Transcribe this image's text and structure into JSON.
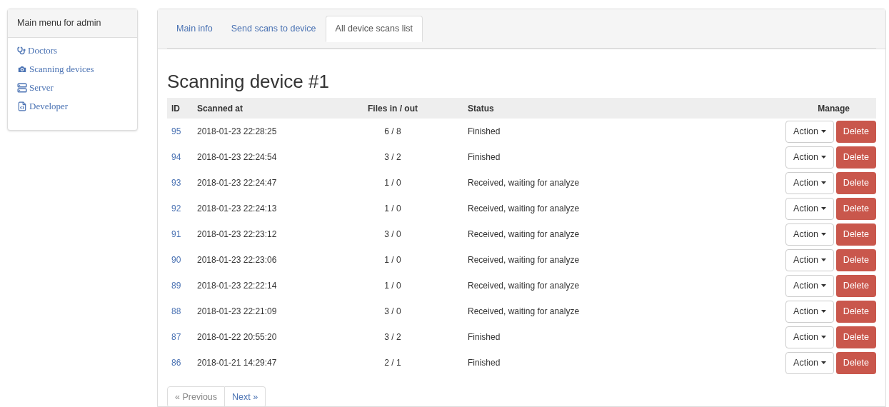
{
  "sidebar": {
    "title": "Main menu for admin",
    "items": [
      {
        "label": "Doctors"
      },
      {
        "label": "Scanning devices"
      },
      {
        "label": "Server"
      },
      {
        "label": "Developer"
      }
    ]
  },
  "tabs": [
    {
      "label": "Main info",
      "selected": false
    },
    {
      "label": "Send scans to device",
      "selected": false
    },
    {
      "label": "All device scans list",
      "selected": true
    }
  ],
  "heading": "Scanning device #1",
  "table": {
    "columns": [
      "ID",
      "Scanned at",
      "Files in / out",
      "Status",
      "Manage"
    ],
    "rows": [
      {
        "id": "95",
        "scanned_at": "2018-01-23 22:28:25",
        "files": "6 / 8",
        "status": "Finished",
        "action": "Action",
        "delete": "Delete"
      },
      {
        "id": "94",
        "scanned_at": "2018-01-23 22:24:54",
        "files": "3 / 2",
        "status": "Finished",
        "action": "Action",
        "delete": "Delete"
      },
      {
        "id": "93",
        "scanned_at": "2018-01-23 22:24:47",
        "files": "1 / 0",
        "status": "Received, waiting for analyze",
        "action": "Action",
        "delete": "Delete"
      },
      {
        "id": "92",
        "scanned_at": "2018-01-23 22:24:13",
        "files": "1 / 0",
        "status": "Received, waiting for analyze",
        "action": "Action",
        "delete": "Delete"
      },
      {
        "id": "91",
        "scanned_at": "2018-01-23 22:23:12",
        "files": "3 / 0",
        "status": "Received, waiting for analyze",
        "action": "Action",
        "delete": "Delete"
      },
      {
        "id": "90",
        "scanned_at": "2018-01-23 22:23:06",
        "files": "1 / 0",
        "status": "Received, waiting for analyze",
        "action": "Action",
        "delete": "Delete"
      },
      {
        "id": "89",
        "scanned_at": "2018-01-23 22:22:14",
        "files": "1 / 0",
        "status": "Received, waiting for analyze",
        "action": "Action",
        "delete": "Delete"
      },
      {
        "id": "88",
        "scanned_at": "2018-01-23 22:21:09",
        "files": "3 / 0",
        "status": "Received, waiting for analyze",
        "action": "Action",
        "delete": "Delete"
      },
      {
        "id": "87",
        "scanned_at": "2018-01-22 20:55:20",
        "files": "3 / 2",
        "status": "Finished",
        "action": "Action",
        "delete": "Delete"
      },
      {
        "id": "86",
        "scanned_at": "2018-01-21 14:29:47",
        "files": "2 / 1",
        "status": "Finished",
        "action": "Action",
        "delete": "Delete"
      }
    ]
  },
  "pagination": [
    {
      "label": "« Previous",
      "disabled": true
    },
    {
      "label": "Next »",
      "disabled": false
    }
  ]
}
